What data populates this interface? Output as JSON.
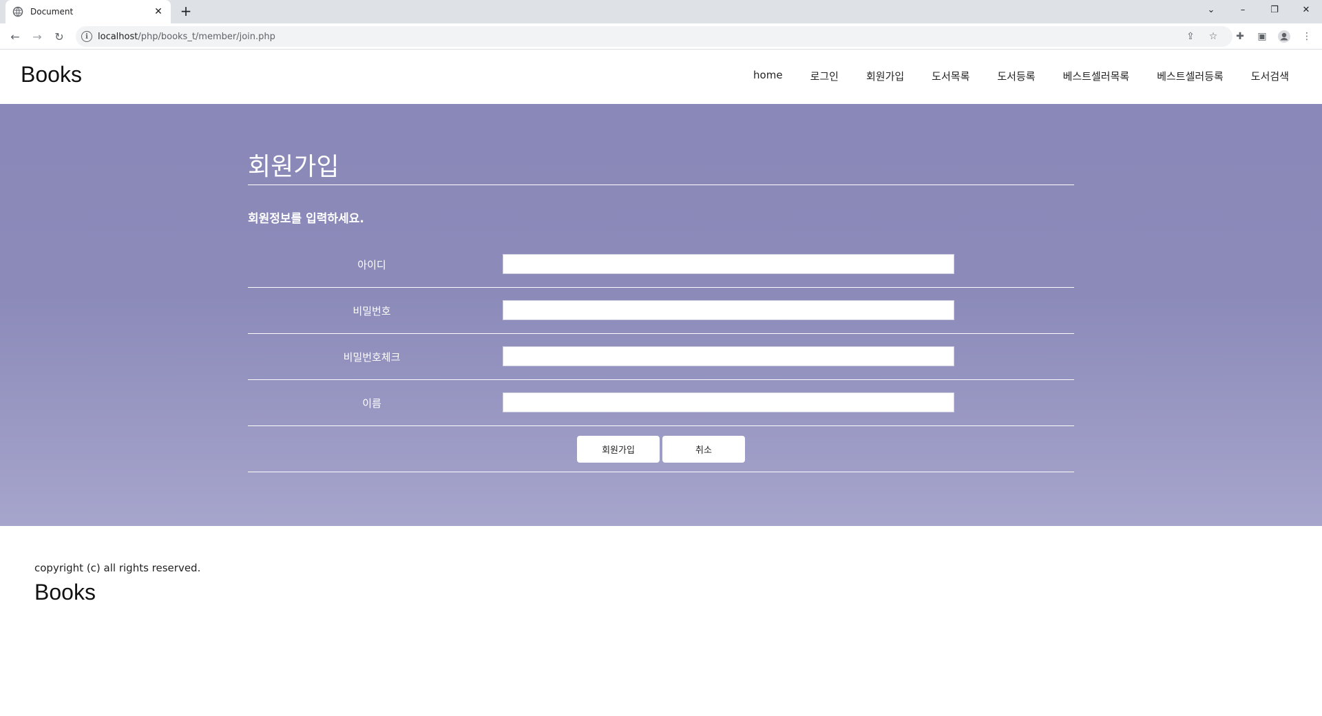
{
  "browser": {
    "tab_title": "Document",
    "url_host": "localhost",
    "url_path": "/php/books_t/member/join.php"
  },
  "header": {
    "logo": "Books",
    "nav": [
      "home",
      "로그인",
      "회원가입",
      "도서목록",
      "도서등록",
      "베스트셀러목록",
      "베스트셀러등록",
      "도서검색"
    ]
  },
  "form": {
    "title": "회원가입",
    "subtitle": "회원정보를 입력하세요.",
    "fields": [
      {
        "label": "아이디",
        "value": ""
      },
      {
        "label": "비밀번호",
        "value": ""
      },
      {
        "label": "비밀번호체크",
        "value": ""
      },
      {
        "label": "이름",
        "value": ""
      }
    ],
    "submit_label": "회원가입",
    "cancel_label": "취소"
  },
  "footer": {
    "copyright": "copyright (c) all rights reserved.",
    "logo": "Books"
  },
  "colors": {
    "hero_top": "#8a88b8",
    "hero_bottom": "#a6a5cc"
  }
}
